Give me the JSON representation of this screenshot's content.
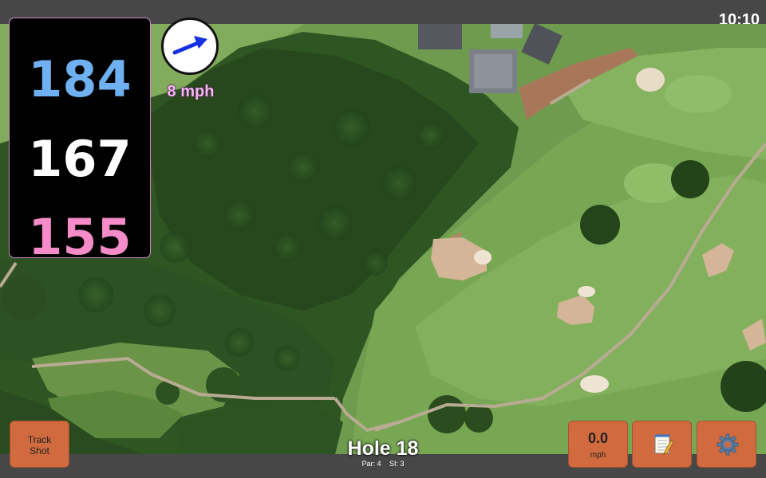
{
  "status": {
    "time": "10:10"
  },
  "distances": {
    "back": "184",
    "middle": "167",
    "front": "155",
    "back_color": "#6fb1f0",
    "middle_color": "#ffffff",
    "front_color": "#f58bc9"
  },
  "wind": {
    "speed": "8 mph",
    "icon": "wind-arrow-icon",
    "direction_hint": "east-northeast"
  },
  "buttons": {
    "track_shot": {
      "line1": "Track",
      "line2": "Shot"
    },
    "speed": {
      "value": "0.0",
      "unit": "mph"
    },
    "notes": {
      "icon": "notepad-icon"
    },
    "settings": {
      "icon": "gear-icon"
    }
  },
  "hole": {
    "title": "Hole 18",
    "par": "Par: 4",
    "si": "SI: 3"
  },
  "colors": {
    "button": "#d16a3f",
    "bar": "#474747",
    "panel": "#000000"
  }
}
